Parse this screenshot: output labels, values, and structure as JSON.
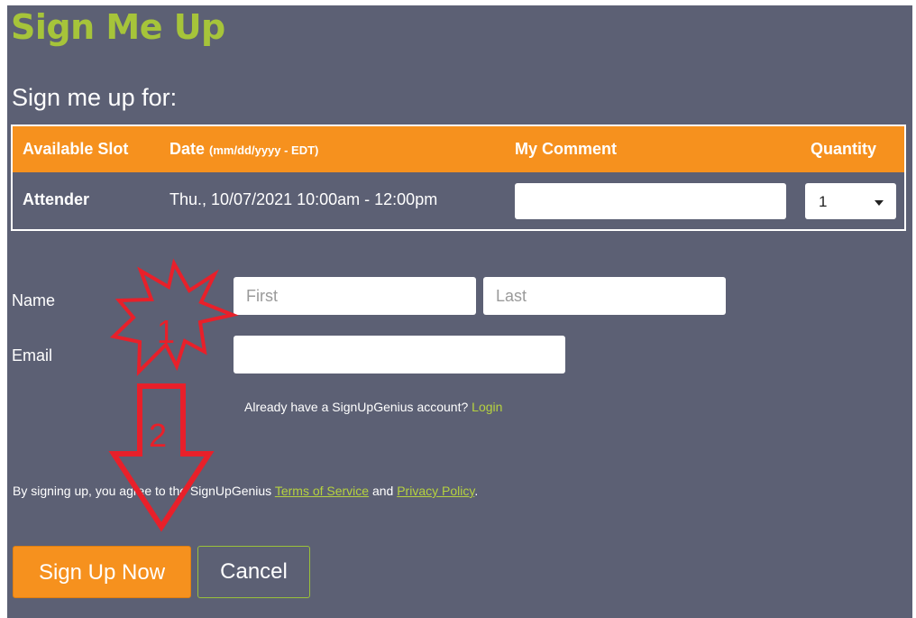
{
  "header": {
    "title": "Sign Me Up",
    "subtitle": "Sign me up for:"
  },
  "slots_table": {
    "columns": {
      "slot": "Available Slot",
      "date": "Date",
      "date_hint": "(mm/dd/yyyy - EDT)",
      "comment": "My Comment",
      "quantity": "Quantity"
    },
    "row": {
      "slot": "Attender",
      "date": "Thu., 10/07/2021 10:00am - 12:00pm",
      "comment": "",
      "quantity": "1"
    }
  },
  "form": {
    "name_label": "Name",
    "first_placeholder": "First",
    "last_placeholder": "Last",
    "email_label": "Email",
    "email_value": "",
    "account_prompt": "Already have a SignUpGenius account?",
    "login_link": "Login"
  },
  "agreement": {
    "prefix": "By signing up, you agree to the SignUpGenius",
    "terms": "Terms of Service",
    "and": "and",
    "privacy": "Privacy Policy",
    "suffix": "."
  },
  "actions": {
    "submit": "Sign Up Now",
    "cancel": "Cancel"
  },
  "annotations": {
    "star_label": "1",
    "arrow_label": "2",
    "color": "#e8202a"
  },
  "colors": {
    "panel": "#5c6074",
    "accent": "#f6911e",
    "brand_green": "#a6c43a"
  }
}
